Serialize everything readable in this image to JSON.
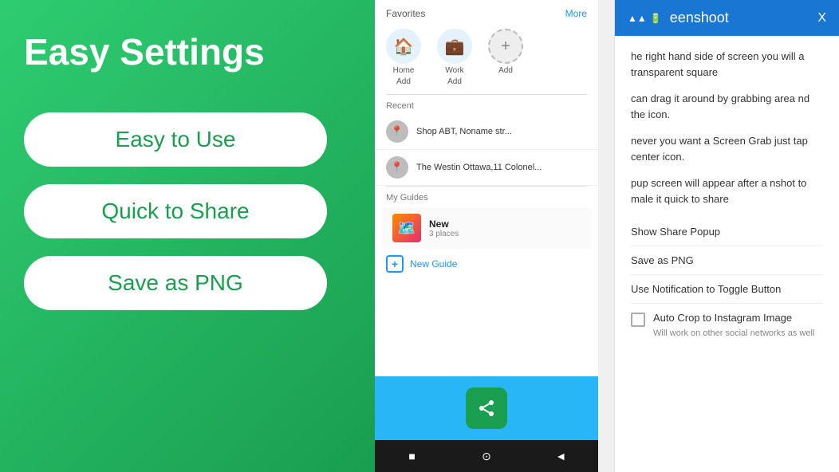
{
  "left": {
    "title": "Easy Settings",
    "buttons": [
      {
        "label": "Easy to Use"
      },
      {
        "label": "Quick to Share"
      },
      {
        "label": "Save as PNG"
      }
    ]
  },
  "middle": {
    "favorites_label": "Favorites",
    "more_label": "More",
    "home_label": "Home",
    "home_sub": "Add",
    "work_label": "Work",
    "work_sub": "Add",
    "add_label": "Add",
    "recent_label": "Recent",
    "recent_items": [
      {
        "text": "Shop ABT, Noname str..."
      },
      {
        "text": "The Westin Ottawa,11 Colonel..."
      }
    ],
    "my_guides_label": "My Guides",
    "guide_name": "New",
    "guide_places": "3 places",
    "new_guide_label": "New Guide",
    "nav_square": "■",
    "nav_circle": "⊙",
    "nav_triangle": "◄"
  },
  "right": {
    "header_title": "eenshoot",
    "header_close": "X",
    "descriptions": [
      "he right hand side of screen you  will a transparent square",
      "can drag it around by  grabbing area nd the icon.",
      "never you want a Screen Grab just tap center icon.",
      "pup screen will appear after a nshot to male it quick to share"
    ],
    "options": [
      {
        "label": "Show Share Popup"
      },
      {
        "label": "Save as PNG"
      },
      {
        "label": "Use Notification to Toggle Button"
      }
    ],
    "checkbox": {
      "label": "Auto Crop to Instagram Image",
      "sub": "Will work on other social networks as well"
    }
  }
}
